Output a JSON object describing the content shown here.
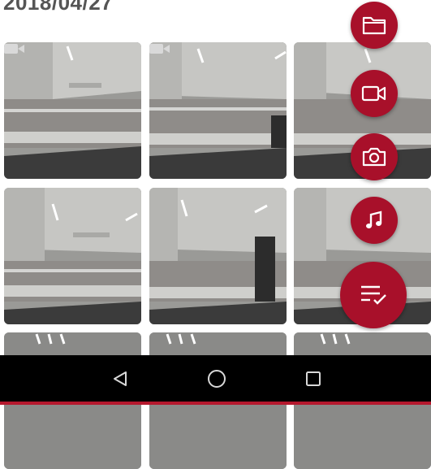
{
  "header": {
    "date": "2018/04/27"
  },
  "thumbnails": [
    {
      "type": "video"
    },
    {
      "type": "video"
    },
    {
      "type": "photo"
    },
    {
      "type": "photo"
    },
    {
      "type": "photo"
    },
    {
      "type": "photo"
    },
    {
      "type": "photo"
    },
    {
      "type": "photo"
    },
    {
      "type": "photo"
    }
  ],
  "fab_menu": {
    "actions": [
      {
        "icon": "folder-icon"
      },
      {
        "icon": "video-camera-icon"
      },
      {
        "icon": "camera-icon"
      },
      {
        "icon": "music-note-icon"
      }
    ],
    "main_icon": "checklist-icon",
    "color": "#a8102a"
  },
  "navbar": {
    "buttons": [
      {
        "icon": "back-triangle-icon"
      },
      {
        "icon": "home-circle-icon"
      },
      {
        "icon": "recents-square-icon"
      }
    ],
    "accent": "#b5182d"
  }
}
